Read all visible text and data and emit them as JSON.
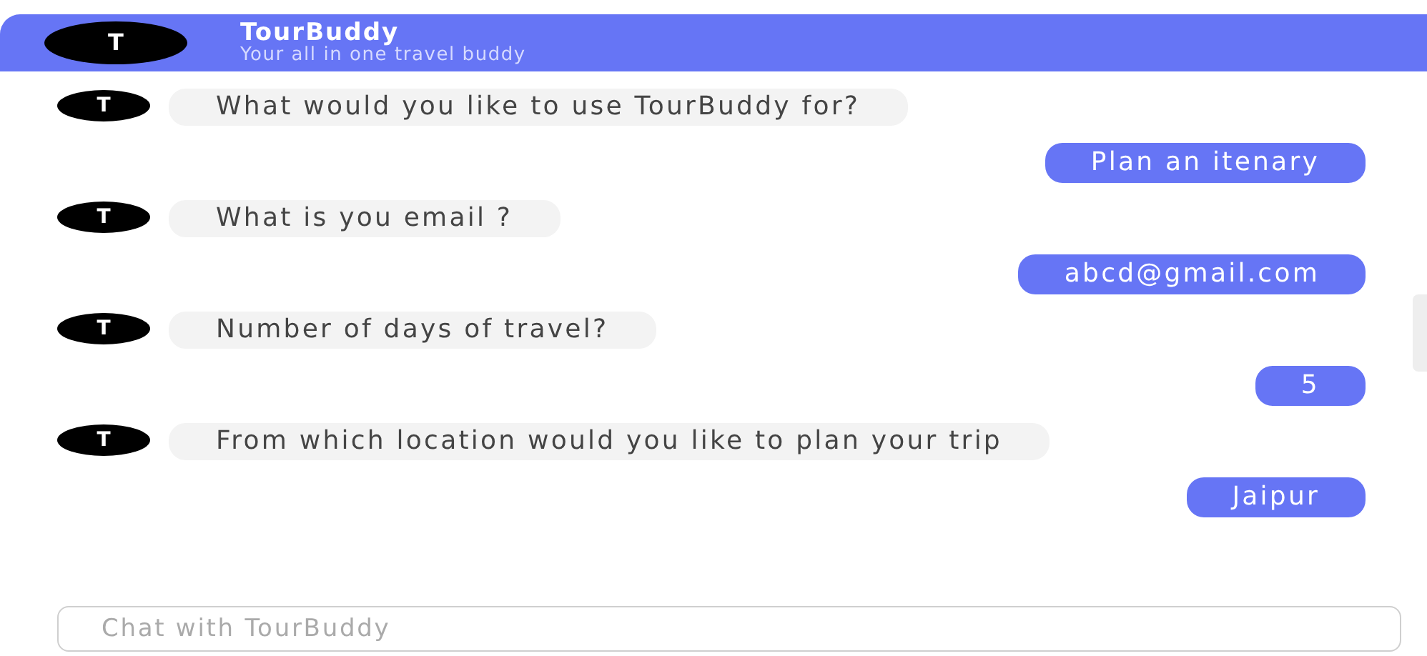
{
  "header": {
    "avatar": "T",
    "title": "TourBuddy",
    "subtitle": "Your all in one travel buddy"
  },
  "messages": [
    {
      "kind": "bot",
      "avatar": "T",
      "text": "What would you like to use TourBuddy for?"
    },
    {
      "kind": "user",
      "text": "Plan an itenary"
    },
    {
      "kind": "bot",
      "avatar": "T",
      "text": "What is you email ?"
    },
    {
      "kind": "user",
      "text": "abcd@gmail.com"
    },
    {
      "kind": "bot",
      "avatar": "T",
      "text": "Number of days of travel?"
    },
    {
      "kind": "user",
      "text": "5"
    },
    {
      "kind": "bot",
      "avatar": "T",
      "text": "From which location would you like to plan your trip"
    },
    {
      "kind": "user",
      "text": "Jaipur"
    }
  ],
  "input": {
    "placeholder": "Chat with TourBuddy"
  }
}
